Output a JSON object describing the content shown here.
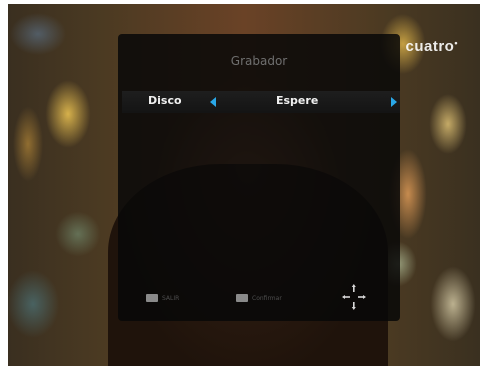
{
  "channel": {
    "logo_text": "cuatro",
    "logo_dot": "•"
  },
  "dialog": {
    "title": "Grabador",
    "option": {
      "label": "Disco",
      "value": "Espere"
    },
    "footer": {
      "exit_label": "SALIR",
      "confirm_label": "Confirmar"
    }
  },
  "icons": {
    "arrow_left": "arrow-left-icon",
    "arrow_right": "arrow-right-icon",
    "nav": "navigation-arrows-icon"
  },
  "colors": {
    "accent_arrow": "#2aa8e8",
    "dialog_bg": "#080808",
    "title_text": "#6f6f6f"
  }
}
